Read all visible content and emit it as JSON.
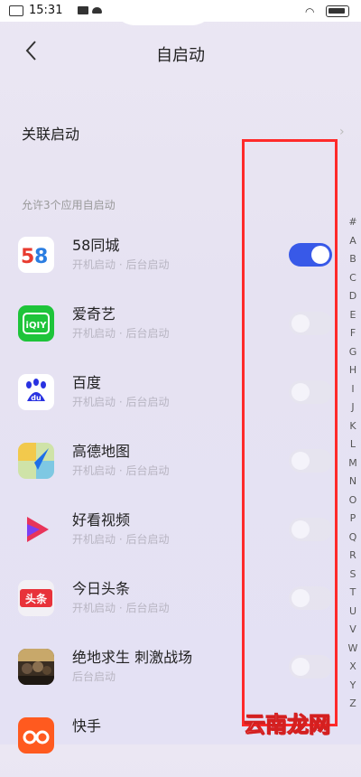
{
  "status_bar": {
    "time": "15:31"
  },
  "header": {
    "title": "自启动"
  },
  "related": {
    "label": "关联启动",
    "chevron": "›"
  },
  "section": {
    "label": "允许3个应用自启动"
  },
  "apps": [
    {
      "name": "58同城",
      "sub": "开机启动 · 后台启动",
      "icon": "58",
      "toggle": true
    },
    {
      "name": "爱奇艺",
      "sub": "开机启动 · 后台启动",
      "icon": "iQIY",
      "toggle": false
    },
    {
      "name": "百度",
      "sub": "开机启动 · 后台启动",
      "icon": "du",
      "toggle": false
    },
    {
      "name": "高德地图",
      "sub": "开机启动 · 后台启动",
      "icon": "",
      "toggle": false
    },
    {
      "name": "好看视频",
      "sub": "开机启动 · 后台启动",
      "icon": "",
      "toggle": false
    },
    {
      "name": "今日头条",
      "sub": "开机启动 · 后台启动",
      "icon": "头条",
      "toggle": false
    },
    {
      "name": "绝地求生 刺激战场",
      "sub": "后台启动",
      "icon": "",
      "toggle": false
    },
    {
      "name": "快手",
      "sub": "",
      "icon": "",
      "toggle": false
    }
  ],
  "alphabet": [
    "#",
    "A",
    "B",
    "C",
    "D",
    "E",
    "F",
    "G",
    "H",
    "I",
    "J",
    "K",
    "L",
    "M",
    "N",
    "O",
    "P",
    "Q",
    "R",
    "S",
    "T",
    "U",
    "V",
    "W",
    "X",
    "Y",
    "Z"
  ],
  "watermark": "云南龙网"
}
